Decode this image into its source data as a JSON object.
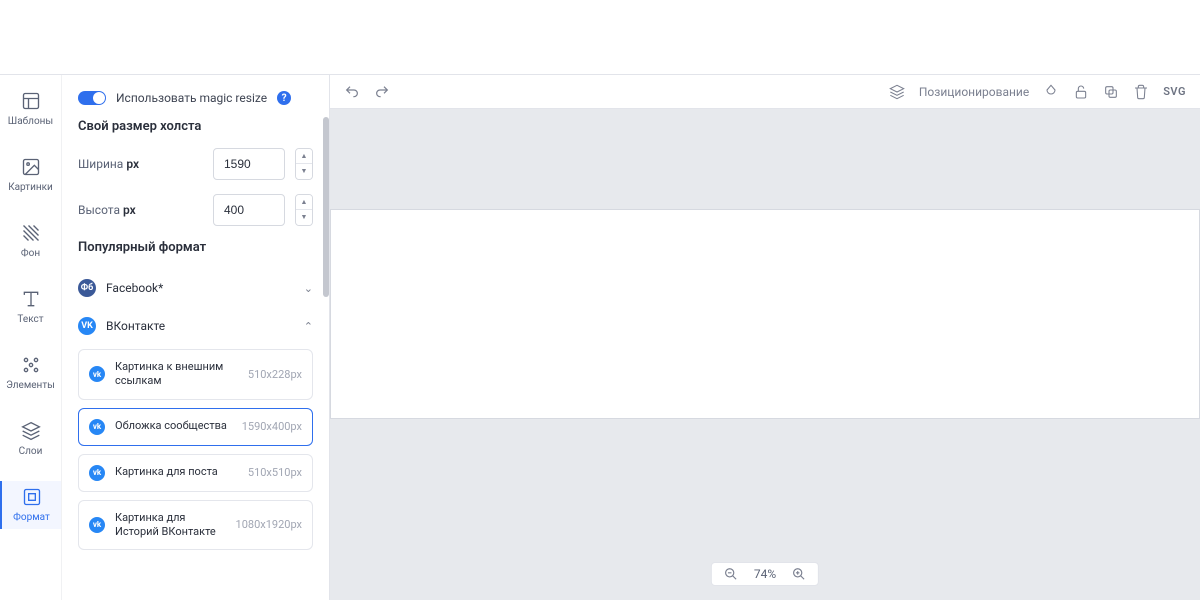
{
  "nav": {
    "items": [
      {
        "label": "Шаблоны"
      },
      {
        "label": "Картинки"
      },
      {
        "label": "Фон"
      },
      {
        "label": "Текст"
      },
      {
        "label": "Элементы"
      },
      {
        "label": "Слои"
      },
      {
        "label": "Формат"
      }
    ]
  },
  "panel": {
    "toggle_label": "Использовать magic resize",
    "section_size": "Свой размер холста",
    "width_label": "Ширина",
    "width_unit": "px",
    "width_value": "1590",
    "height_label": "Высота",
    "height_unit": "px",
    "height_value": "400",
    "section_popular": "Популярный формат",
    "groups": [
      {
        "badge": "Фб",
        "label": "Facebook*",
        "expanded": false
      },
      {
        "badge": "VK",
        "label": "ВКонтакте",
        "expanded": true
      }
    ],
    "vk_formats": [
      {
        "label": "Картинка к внешним ссылкам",
        "dims": "510x228px",
        "selected": false
      },
      {
        "label": "Обложка сообщества",
        "dims": "1590x400px",
        "selected": true
      },
      {
        "label": "Картинка для поста",
        "dims": "510x510px",
        "selected": false
      },
      {
        "label": "Картинка для Историй ВКонтакте",
        "dims": "1080x1920px",
        "selected": false
      }
    ]
  },
  "toolbar": {
    "positioning": "Позиционирование",
    "svg_label": "SVG"
  },
  "zoom": {
    "value": "74%"
  }
}
